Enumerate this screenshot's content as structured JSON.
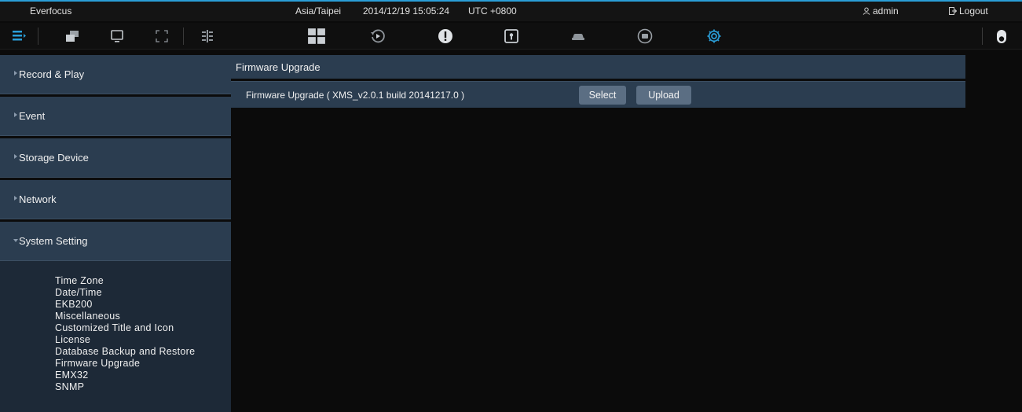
{
  "topbar": {
    "brand": "Everfocus",
    "timezone": "Asia/Taipei",
    "datetime": "2014/12/19 15:05:24",
    "utc": "UTC +0800",
    "user": "admin",
    "logout": "Logout"
  },
  "toolbar": {
    "icons": [
      "list-menu-icon",
      "windows-icon",
      "monitor-icon",
      "fullscreen-icon",
      "layout-split-icon",
      "grid-layout-icon",
      "playback-icon",
      "alarm-icon",
      "lock-box-icon",
      "car-icon",
      "face-icon",
      "settings-gear-icon",
      "lock-icon"
    ],
    "accent_color": "#2a9ed8"
  },
  "sidebar": {
    "items": [
      {
        "label": "Record & Play"
      },
      {
        "label": "Event"
      },
      {
        "label": "Storage Device"
      },
      {
        "label": "Network"
      },
      {
        "label": "System Setting"
      }
    ],
    "submenu": [
      "Time Zone",
      "Date/Time",
      "EKB200",
      "Miscellaneous",
      "Customized Title and Icon",
      "License",
      "Database Backup and Restore",
      "Firmware Upgrade",
      "EMX32",
      "SNMP"
    ]
  },
  "panel": {
    "title": "Firmware Upgrade",
    "row_label": "Firmware Upgrade ( XMS_v2.0.1 build 20141217.0 )",
    "select_label": "Select",
    "upload_label": "Upload"
  }
}
